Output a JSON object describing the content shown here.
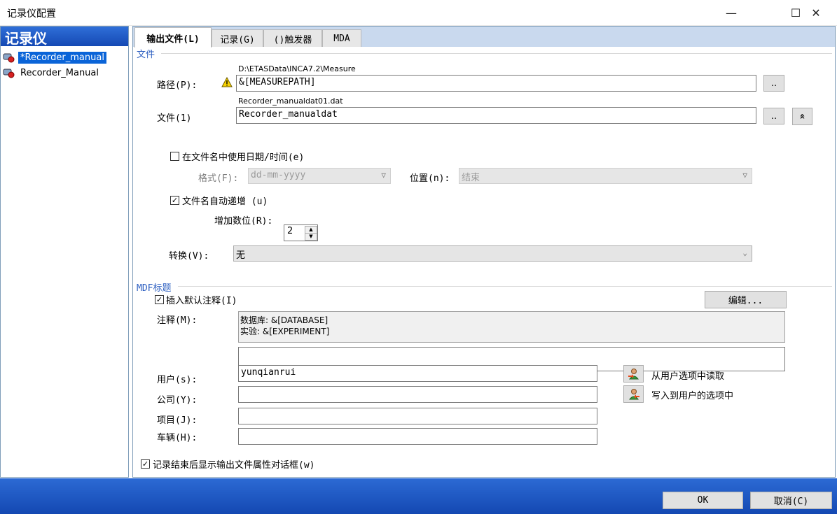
{
  "window": {
    "title": "记录仪配置",
    "minimize_glyph": "—",
    "maximize_glyph": "☐",
    "close_glyph": "✕"
  },
  "left_panel": {
    "header": "记录仪",
    "items": [
      {
        "label": "*Recorder_manual",
        "icon": "recorder-icon",
        "selected": true
      },
      {
        "label": "Recorder_Manual",
        "icon": "recorder-icon",
        "selected": false
      }
    ]
  },
  "tabs": [
    {
      "label": "输出文件(L)",
      "active": true
    },
    {
      "label": "记录(G)",
      "active": false
    },
    {
      "label": "()触发器",
      "active": false
    },
    {
      "label": "MDA",
      "active": false
    }
  ],
  "file_group": {
    "title": "文件",
    "path_hint": "D:\\ETASData\\INCA7.2\\Measure",
    "path_label": "路径(P):",
    "path_value": "&[MEASUREPATH]",
    "browse_label": "..",
    "file_hint": "Recorder_manualdat01.dat",
    "file_label": "文件(1)",
    "file_value": "Recorder_manualdat",
    "file_browse_label": "..",
    "collapse_glyph": "«",
    "use_datetime_label": "在文件名中使用日期/时间(e)",
    "use_datetime_checked": false,
    "format_label": "格式(F):",
    "format_value": "dd-mm-yyyy",
    "position_label": "位置(n):",
    "position_value": "结束",
    "auto_increment_label": "文件名自动递增 (u)",
    "auto_increment_checked": true,
    "digits_label": "增加数位(R):",
    "digits_value": "2",
    "convert_label": "转换(V):",
    "convert_value": "无"
  },
  "mdf_group": {
    "title": "MDF标题",
    "insert_comment_label": "插入默认注释(I)",
    "insert_comment_checked": true,
    "edit_button": "编辑...",
    "comment_label": "注释(M):",
    "comment_line1": "数据库: &[DATABASE]",
    "comment_line2": "实验: &[EXPERIMENT]",
    "user_label": "用户(s):",
    "user_value": "yunqianrui",
    "company_label": "公司(Y):",
    "company_value": "",
    "project_label": "项目(J):",
    "project_value": "",
    "vehicle_label": "车辆(H):",
    "vehicle_value": "",
    "read_from_user_label": "从用户选项中读取",
    "write_to_user_label": "写入到用户的选项中"
  },
  "show_dialog_label": "记录结束后显示输出文件属性对话框(w)",
  "show_dialog_checked": true,
  "footer": {
    "ok_label": "OK",
    "cancel_label": "取消(C)"
  },
  "colors": {
    "header_blue": "#1549b4",
    "selection": "#0a64d8",
    "group_title": "#2d5fc1",
    "tabstrip": "#c9d9ee"
  }
}
